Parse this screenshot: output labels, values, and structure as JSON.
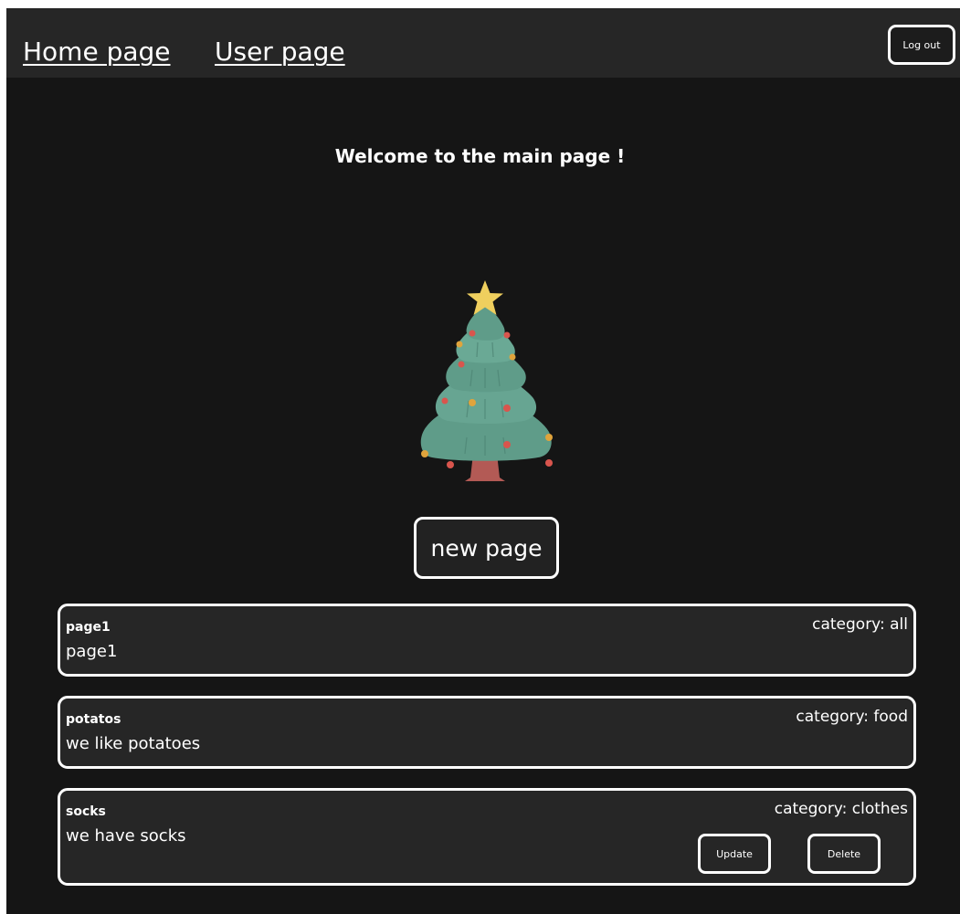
{
  "nav": {
    "home_label": "Home page",
    "user_label": "User page",
    "logout_label": "Log out"
  },
  "main": {
    "welcome": "Welcome to the main page !",
    "new_page_label": "new page"
  },
  "pages": [
    {
      "title": "page1",
      "content": "page1",
      "category": "category: all"
    },
    {
      "title": "potatos",
      "content": "we like potatoes",
      "category": "category: food"
    },
    {
      "title": "socks",
      "content": "we have socks",
      "category": "category: clothes",
      "update_label": "Update",
      "delete_label": "Delete"
    }
  ],
  "colors": {
    "background": "#151515",
    "navbar": "#262626",
    "card": "#262626",
    "border": "#ffffff",
    "tree_green": "#5e9a88",
    "star": "#efcf5e"
  },
  "icons": {
    "decoration": "christmas-tree-icon"
  }
}
